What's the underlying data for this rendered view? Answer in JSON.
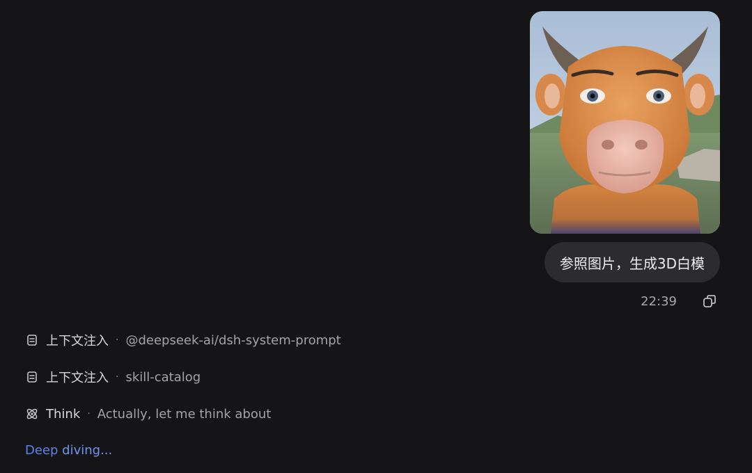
{
  "user_message": {
    "attachment_icon": "cartoon-bull-image",
    "text": "参照图片，生成3D白模",
    "time": "22:39",
    "copy_icon": "copy-icon"
  },
  "steps": [
    {
      "icon": "document-icon",
      "name": "上下文注入",
      "separator": "·",
      "detail": "@deepseek-ai/dsh-system-prompt"
    },
    {
      "icon": "document-icon",
      "name": "上下文注入",
      "separator": "·",
      "detail": "skill-catalog"
    },
    {
      "icon": "atom-icon",
      "name": "Think",
      "separator": "·",
      "detail": "Actually, let me think about"
    }
  ],
  "status": {
    "text_a": "Deep ",
    "text_b": "diving...",
    "color": "#5b82e8"
  }
}
